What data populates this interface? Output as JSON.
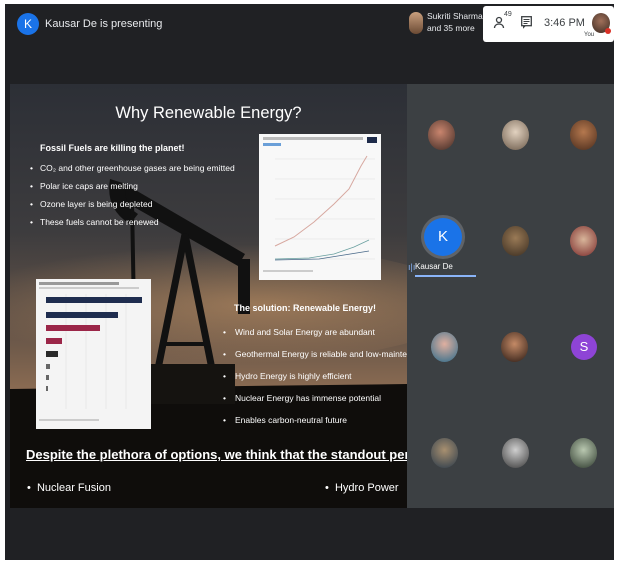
{
  "presenter": {
    "initial": "K",
    "text": "Kausar De is presenting"
  },
  "participants": {
    "line1": "Sukriti Sharma S...",
    "line2": "and 35 more"
  },
  "tray": {
    "people_badge": "49",
    "time": "3:46 PM",
    "you_label": "You"
  },
  "slide": {
    "title": "Why Renewable Energy?",
    "fossil_heading": "Fossil Fuels are killing the planet!",
    "fossil_points": [
      "CO₂ and other greenhouse gases are being  emitted",
      "Polar ice caps are melting",
      "Ozone layer is being depleted",
      "These fuels cannot be renewed"
    ],
    "solution_heading": "The solution: Renewable Energy!",
    "solution_points": [
      "Wind and Solar Energy are abundant",
      "Geothermal Energy is reliable and low-maintenance",
      "Hydro Energy is highly efficient",
      "Nuclear Energy has immense potential",
      "Enables carbon-neutral future"
    ],
    "closing": "Despite the plethora of options, we think that the standout performers are",
    "bottom_left": "Nuclear Fusion",
    "bottom_right": "Hydro Power"
  },
  "tiles": {
    "speaker_initial": "K",
    "speaker_name": "Kausar De",
    "letter_tile": "S"
  },
  "colors": {
    "meet_bg": "#202124",
    "tile_bg": "#3c4043",
    "accent_blue": "#1a73e8",
    "letter_tile_purple": "#8e44d6",
    "speaking_blue": "#8ab4f8"
  }
}
